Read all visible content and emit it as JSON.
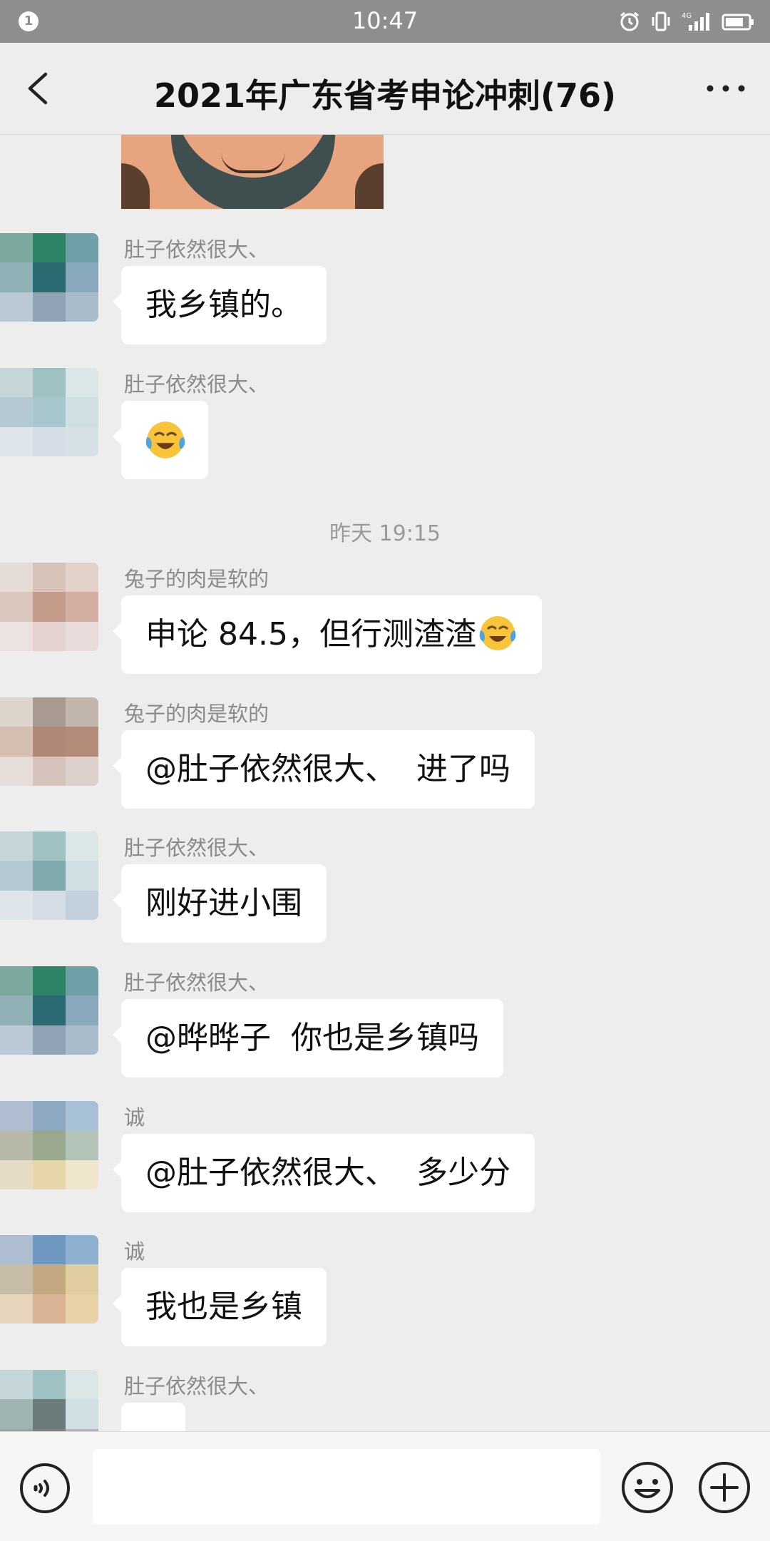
{
  "status_bar": {
    "notification_count": "1",
    "time": "10:47",
    "network": "4G"
  },
  "header": {
    "title": "2021年广东省考申论冲刺(76)"
  },
  "messages": [
    {
      "sender": "肚子依然很大、",
      "text": "我乡镇的。"
    },
    {
      "sender": "肚子依然很大、",
      "text": "",
      "emoji": "face-with-tears-of-joy"
    },
    {
      "sender": "兔子的肉是软的",
      "text": "申论 84.5，但行测渣渣",
      "emoji": "face-with-tears-of-joy"
    },
    {
      "sender": "兔子的肉是软的",
      "text": "@肚子依然很大、  进了吗"
    },
    {
      "sender": "肚子依然很大、",
      "text": "刚好进小围"
    },
    {
      "sender": "肚子依然很大、",
      "text": "@晔晔子  你也是乡镇吗"
    },
    {
      "sender": "诚",
      "text": "@肚子依然很大、  多少分"
    },
    {
      "sender": "诚",
      "text": "我也是乡镇"
    },
    {
      "sender": "肚子依然很大、",
      "text": ""
    }
  ],
  "timestamp": "昨天 19:15",
  "input": {
    "placeholder": ""
  },
  "colors": {
    "status_bar": "#8e8e8e",
    "background": "#ededed",
    "bubble": "#ffffff",
    "sender_text": "#8a8a8a"
  }
}
